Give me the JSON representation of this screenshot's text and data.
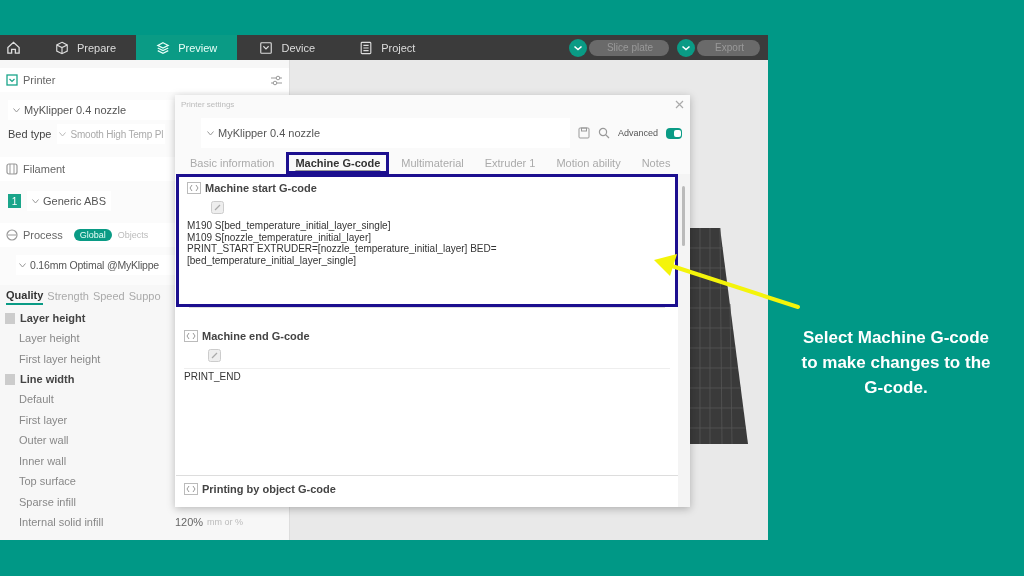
{
  "topbar": {
    "tabs": [
      {
        "label": "Prepare",
        "selected": false
      },
      {
        "label": "Preview",
        "selected": true
      },
      {
        "label": "Device",
        "selected": false
      },
      {
        "label": "Project",
        "selected": false
      }
    ],
    "buttons": [
      "Slice plate",
      "Export"
    ]
  },
  "sidebar": {
    "printer": {
      "title": "Printer",
      "preset": "MyKlipper 0.4 nozzle",
      "bed_type_label": "Bed type",
      "bed_type": "Smooth High Temp Pl"
    },
    "filament": {
      "title": "Filament",
      "items": [
        {
          "index": "1",
          "name": "Generic ABS",
          "color": "#1aa58a"
        }
      ]
    },
    "process": {
      "title": "Process",
      "scope": [
        {
          "label": "Global",
          "selected": true
        },
        {
          "label": "Objects",
          "selected": false
        }
      ],
      "preset": "0.16mm Optimal @MyKlippe"
    },
    "tabs": [
      {
        "label": "Quality",
        "selected": true
      },
      {
        "label": "Strength",
        "selected": false
      },
      {
        "label": "Speed",
        "selected": false
      },
      {
        "label": "Suppo",
        "selected": false
      }
    ],
    "groups": [
      {
        "title": "Layer height",
        "options": [
          {
            "label": "Layer height"
          },
          {
            "label": "First layer height"
          }
        ]
      },
      {
        "title": "Line width",
        "options": [
          {
            "label": "Default"
          },
          {
            "label": "First layer"
          },
          {
            "label": "Outer wall"
          },
          {
            "label": "Inner wall"
          },
          {
            "label": "Top surface"
          },
          {
            "label": "Sparse infill"
          },
          {
            "label": "Internal solid infill",
            "value": "120%",
            "unit": "mm or %"
          }
        ]
      }
    ]
  },
  "dialog": {
    "title": "Printer settings",
    "preset": "MyKlipper 0.4 nozzle",
    "advanced": {
      "label": "Advanced",
      "on": true
    },
    "tabs": [
      {
        "label": "Basic information",
        "selected": false,
        "highlighted": false
      },
      {
        "label": "Machine G-code",
        "selected": true,
        "highlighted": true
      },
      {
        "label": "Multimaterial",
        "selected": false,
        "highlighted": false
      },
      {
        "label": "Extruder 1",
        "selected": false,
        "highlighted": false
      },
      {
        "label": "Motion ability",
        "selected": false,
        "highlighted": false
      },
      {
        "label": "Notes",
        "selected": false,
        "highlighted": false
      }
    ],
    "sections": [
      {
        "title": "Machine start G-code",
        "highlighted": true,
        "lines": [
          "M190 S[bed_temperature_initial_layer_single]",
          "M109 S[nozzle_temperature_initial_layer]",
          "PRINT_START EXTRUDER=[nozzle_temperature_initial_layer] BED=",
          "[bed_temperature_initial_layer_single]"
        ]
      },
      {
        "title": "Machine end G-code",
        "highlighted": false,
        "lines": [
          "PRINT_END"
        ]
      },
      {
        "title": "Printing by object G-code",
        "highlighted": false
      }
    ]
  },
  "annotation": {
    "caption": "Select Machine G-code to make changes to the G-code."
  }
}
